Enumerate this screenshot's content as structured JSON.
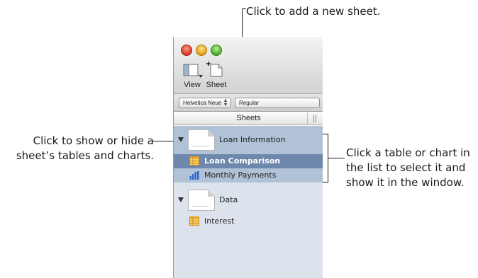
{
  "callouts": {
    "add_sheet": "Click to add a new sheet.",
    "show_hide_line1": "Click to show or hide a",
    "show_hide_line2": "sheet’s tables and charts.",
    "select_line1": "Click a table or chart in",
    "select_line2": "the list to select it and",
    "select_line3": "show it in the window."
  },
  "toolbar": {
    "view_label": "View",
    "sheet_label": "Sheet"
  },
  "format_bar": {
    "font_family": "Helvetica Neue",
    "font_style": "Regular"
  },
  "sidebar": {
    "header": "Sheets",
    "sheets": [
      {
        "name": "Loan Information",
        "expanded": true,
        "items": [
          {
            "name": "Loan Comparison",
            "type": "table",
            "selected": true
          },
          {
            "name": "Monthly Payments",
            "type": "chart",
            "selected": false
          }
        ]
      },
      {
        "name": "Data",
        "expanded": true,
        "items": [
          {
            "name": "Interest",
            "type": "table",
            "selected": false
          }
        ]
      }
    ]
  },
  "icons": {
    "traffic_lights": [
      "close-icon",
      "minimize-icon",
      "zoom-icon"
    ],
    "view": "view-icon",
    "sheet": "add-sheet-icon",
    "table": "table-icon",
    "chart": "bar-chart-icon"
  },
  "colors": {
    "selected_row": "#6e88ad",
    "highlighted_row": "#b1c1d6",
    "sidebar_bg": "#dde3ec",
    "table_icon": "#f2b43c"
  }
}
